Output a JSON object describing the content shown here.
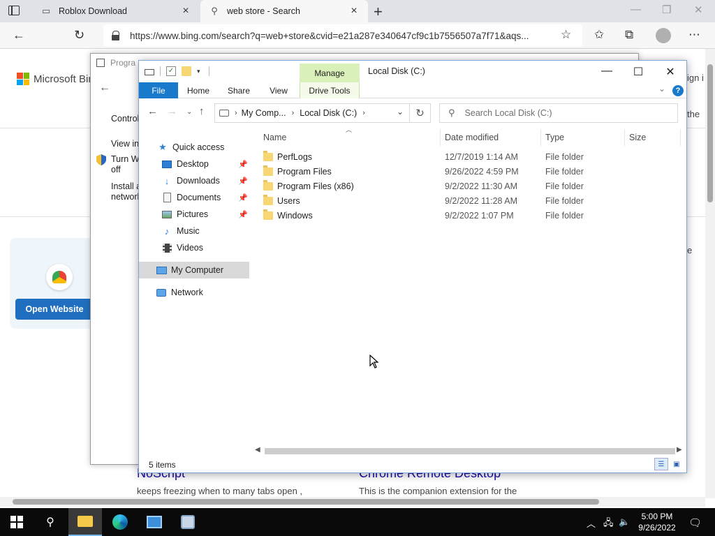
{
  "browser": {
    "tabs": [
      {
        "title": "Roblox Download",
        "active": false,
        "icon": "generic-page-icon"
      },
      {
        "title": "web store - Search",
        "active": true,
        "icon": "search-icon"
      }
    ],
    "url": "https://www.bing.com/search?q=web+store&cvid=e21a287e340647cf9c1b7556507a7f71&aqs...",
    "bing_brand": "Microsoft Bing",
    "card_button": "Open Website",
    "bg_results": [
      {
        "title": "NoScript",
        "desc": "keeps freezing when to many tabs open ,"
      },
      {
        "title": "Chrome Remote Desktop",
        "desc": "This is the companion extension for the"
      }
    ],
    "bg_right_fragments": [
      "ign i",
      "the",
      "e"
    ]
  },
  "control_panel": {
    "title": "Progra",
    "links": [
      "Control",
      "View in",
      "Turn W",
      "off",
      "Install a",
      "network"
    ]
  },
  "explorer": {
    "title": "Local Disk (C:)",
    "manage_tab": "Manage",
    "ribbon_tabs": [
      "File",
      "Home",
      "Share",
      "View",
      "Drive Tools"
    ],
    "breadcrumb": [
      "My Comp...",
      "Local Disk (C:)"
    ],
    "search_placeholder": "Search Local Disk (C:)",
    "nav_pane": [
      {
        "label": "Quick access",
        "icon": "star-icon",
        "pinned": false,
        "indent": 1
      },
      {
        "label": "Desktop",
        "icon": "desktop-icon",
        "pinned": true,
        "indent": 2
      },
      {
        "label": "Downloads",
        "icon": "download-icon",
        "pinned": true,
        "indent": 2
      },
      {
        "label": "Documents",
        "icon": "documents-icon",
        "pinned": true,
        "indent": 2
      },
      {
        "label": "Pictures",
        "icon": "pictures-icon",
        "pinned": true,
        "indent": 2
      },
      {
        "label": "Music",
        "icon": "music-icon",
        "pinned": false,
        "indent": 2
      },
      {
        "label": "Videos",
        "icon": "videos-icon",
        "pinned": false,
        "indent": 2
      },
      {
        "label": "My Computer",
        "icon": "computer-icon",
        "pinned": false,
        "indent": 1,
        "selected": true
      },
      {
        "label": "Network",
        "icon": "network-icon",
        "pinned": false,
        "indent": 1
      }
    ],
    "columns": [
      "Name",
      "Date modified",
      "Type",
      "Size"
    ],
    "files": [
      {
        "name": "PerfLogs",
        "date": "12/7/2019 1:14 AM",
        "type": "File folder"
      },
      {
        "name": "Program Files",
        "date": "9/26/2022 4:59 PM",
        "type": "File folder"
      },
      {
        "name": "Program Files (x86)",
        "date": "9/2/2022 11:30 AM",
        "type": "File folder"
      },
      {
        "name": "Users",
        "date": "9/2/2022 11:28 AM",
        "type": "File folder"
      },
      {
        "name": "Windows",
        "date": "9/2/2022 1:07 PM",
        "type": "File folder"
      }
    ],
    "status": "5 items"
  },
  "taskbar": {
    "time": "5:00 PM",
    "date": "9/26/2022"
  },
  "colors": {
    "accent": "#1979ca",
    "manage_green": "#d9f0b9",
    "taskbar": "#0a0a0a"
  }
}
